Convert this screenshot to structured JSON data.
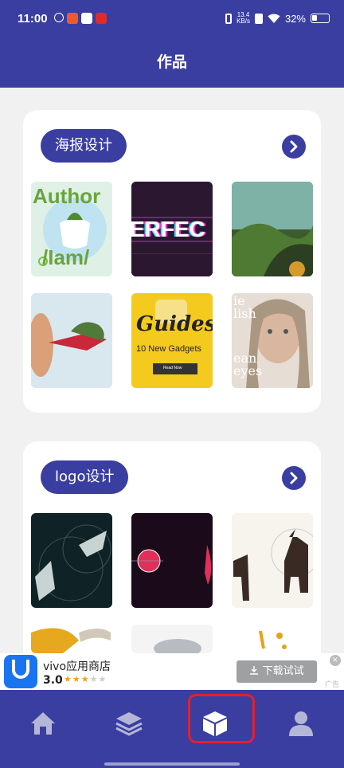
{
  "status_bar": {
    "time": "11:00",
    "net_speed_top": "13.4",
    "net_speed_bottom": "KB/s",
    "battery": "32%"
  },
  "app_bar": {
    "title": "作品"
  },
  "sections": [
    {
      "label": "海报设计"
    },
    {
      "label": "logo设计"
    }
  ],
  "posters": {
    "p1_line1": "Author",
    "p1_line2": "/Iam/",
    "p2_text": "ERFEC",
    "p5_title": "Guides",
    "p5_sub": "10 New Gadgets",
    "p5_btn": "Read Now",
    "p6_l1": "ie",
    "p6_l2": "lish",
    "p6_l3": "ean",
    "p6_l4": "eyes"
  },
  "ad": {
    "app_name": "vivo应用商店",
    "rating": "3.0",
    "button": "下载试试",
    "tag": "广告",
    "close": "×"
  },
  "bottom_nav": {
    "items": [
      "home-icon",
      "layers-icon",
      "box-icon",
      "user-icon"
    ]
  },
  "colors": {
    "primary": "#3a3ea1",
    "highlight": "#e5202a"
  }
}
